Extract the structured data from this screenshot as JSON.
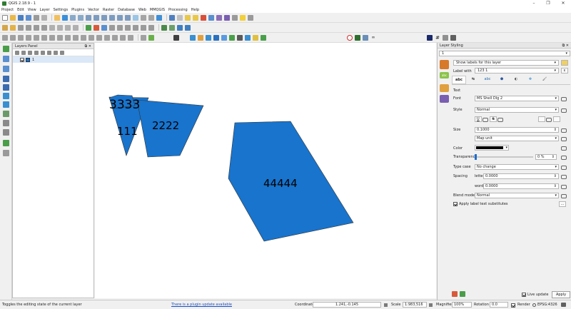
{
  "window": {
    "title": "QGIS 2.18.9 - 1",
    "minimize": "–",
    "maximize": "❐",
    "close": "✕"
  },
  "menu": [
    "Project",
    "Edit",
    "View",
    "Layer",
    "Settings",
    "Plugins",
    "Vector",
    "Raster",
    "Database",
    "Web",
    "MMQGIS",
    "Processing",
    "Help"
  ],
  "layers_panel": {
    "title": "Layers Panel",
    "float_icon": "⧉",
    "close_icon": "✕",
    "layer_name": "1"
  },
  "map": {
    "fill_color": "#1874cd",
    "labels": [
      "3333",
      "111",
      "2222",
      "44444"
    ]
  },
  "styling": {
    "title": "Layer Styling",
    "layer_combo": "1",
    "mode_combo": "Show labels for this layer",
    "label_with_label": "Label with",
    "label_with_value": "123 1",
    "epsilon": "ε",
    "tab_abc": "abc",
    "section": "Text",
    "font_label": "Font",
    "font_value": "MS Shell Dlg 2",
    "style_label": "Style",
    "style_value": "Normal",
    "btn_u": "U",
    "btn_s": "S",
    "size_label": "Size",
    "size_value": "0.1000",
    "unit_value": "Map unit",
    "color_label": "Color",
    "transparency_label": "Transparency",
    "transparency_value": "0 %",
    "typecase_label": "Type case",
    "typecase_value": "No change",
    "spacing_label": "Spacing",
    "letter_label": "letter",
    "letter_value": "0.0000",
    "word_label": "word",
    "word_value": "0.0000",
    "blend_label": "Blend mode",
    "blend_value": "Normal",
    "substitutes_label": "Apply label text substitutes",
    "more_button": "…",
    "live_update": "Live update",
    "apply": "Apply"
  },
  "status": {
    "hint": "Toggles the editing state of the current layer",
    "plugin_update": "There is a plugin update available",
    "coordinate_label": "Coordinate",
    "coordinate_value": "1.241,-0.145",
    "scale_label": "Scale",
    "scale_value": "1:983,516",
    "magnifier_label": "Magnifier",
    "magnifier_value": "100%",
    "rotation_label": "Rotation",
    "rotation_value": "0.0",
    "render_label": "Render",
    "epsg": "EPSG:4326"
  }
}
